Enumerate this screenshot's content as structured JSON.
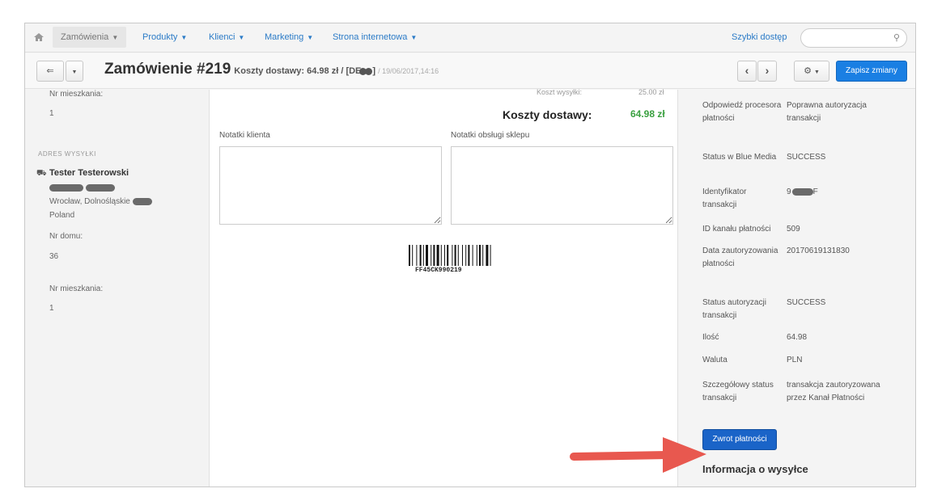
{
  "nav": {
    "items": [
      "Zamówienia",
      "Produkty",
      "Klienci",
      "Marketing",
      "Strona internetowa"
    ],
    "quick_access": "Szybki dostęp"
  },
  "header": {
    "back_label": "⇐",
    "title": "Zamówienie #219",
    "subtitle": "Koszty dostawy: 64.98 zł / [DE",
    "subtitle_end": "]",
    "date": "/ 19/06/2017,14:16",
    "prev": "‹",
    "next": "›",
    "save_label": "Zapisz zmiany"
  },
  "left": {
    "apt_label_top": "Nr mieszkania:",
    "apt_value_top": "1",
    "section_title": "ADRES WYSYŁKI",
    "name": "Tester Testerowski",
    "city_line": "Wrocław, Dolnośląskie",
    "country": "Poland",
    "house_label": "Nr domu:",
    "house_value": "36",
    "apt_label": "Nr mieszkania:",
    "apt_value": "1"
  },
  "center": {
    "faded_label": "Koszt wysyłki:",
    "faded_value": "25.00 zł",
    "shipping_label": "Koszty dostawy:",
    "shipping_value": "64.98 zł",
    "client_notes_label": "Notatki klienta",
    "shop_notes_label": "Notatki obsługi sklepu",
    "barcode_text": "FF45CK990219"
  },
  "right": {
    "rows": [
      {
        "k": "Odpowiedź procesora płatności",
        "v": "Poprawna autoryzacja transakcji"
      },
      {
        "k": "Status w Blue Media",
        "v": "SUCCESS"
      },
      {
        "k": "Identyfikator transakcji",
        "v": "9"
      },
      {
        "k": "ID kanału płatności",
        "v": "509"
      },
      {
        "k": "Data zautoryzowania płatności",
        "v": "20170619131830"
      },
      {
        "k": "Status autoryzacji transakcji",
        "v": "SUCCESS"
      },
      {
        "k": "Ilość",
        "v": "64.98"
      },
      {
        "k": "Waluta",
        "v": "PLN"
      },
      {
        "k": "Szczegółowy status transakcji",
        "v": "transakcja zautoryzowana przez Kanał Płatności"
      }
    ],
    "refund_label": "Zwrot płatności",
    "shipping_info_title": "Informacja o wysyłce"
  },
  "colors": {
    "primary": "#1a7fe3",
    "link": "#2b7bc7",
    "success": "#3aa040",
    "arrow": "#e8584f"
  }
}
